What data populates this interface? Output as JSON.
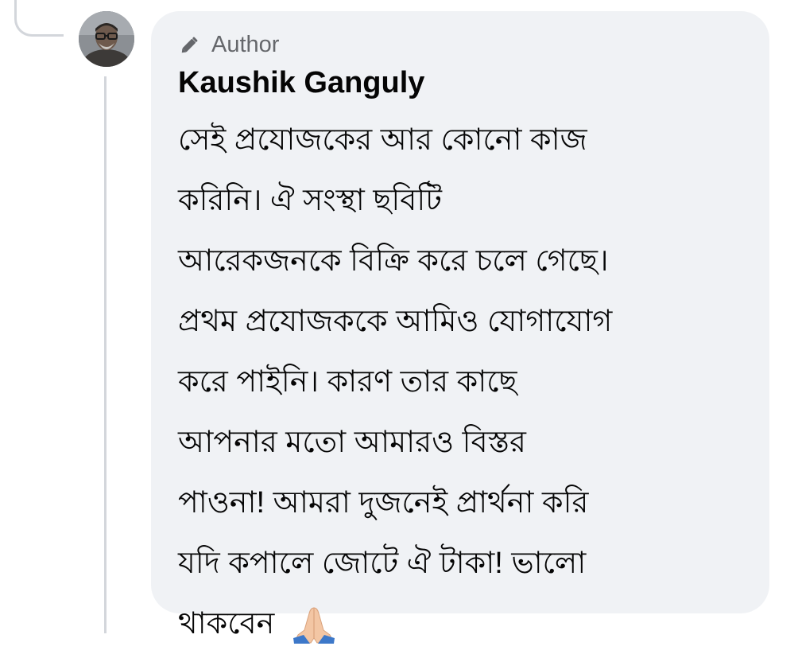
{
  "thread": {
    "reply_connector": true
  },
  "comment": {
    "badge_icon": "pencil-icon",
    "badge_label": "Author",
    "author_name": "Kaushik Ganguly",
    "lines": [
      "সেই প্রযোজকের আর কোনো কাজ",
      "করিনি। ঐ সংস্থা ছবিটি",
      "আরেকজনকে বিক্রি করে চলে গেছে।",
      "প্রথম প্রযোজককে আমিও যোগাযোগ",
      "করে পাইনি। কারণ তার কাছে",
      "আপনার মতো আমারও বিস্তর",
      "পাওনা! আমরা দুজনেই প্রার্থনা করি",
      "যদি কপালে জোটে ঐ টাকা! ভালো",
      "থাকবেন"
    ],
    "trailing_emoji": "folded-hands-emoji"
  },
  "colors": {
    "bubble_background": "#f0f2f5",
    "thread_line": "#d3d6db",
    "secondary_text": "#65676b",
    "primary_text": "#050505"
  }
}
